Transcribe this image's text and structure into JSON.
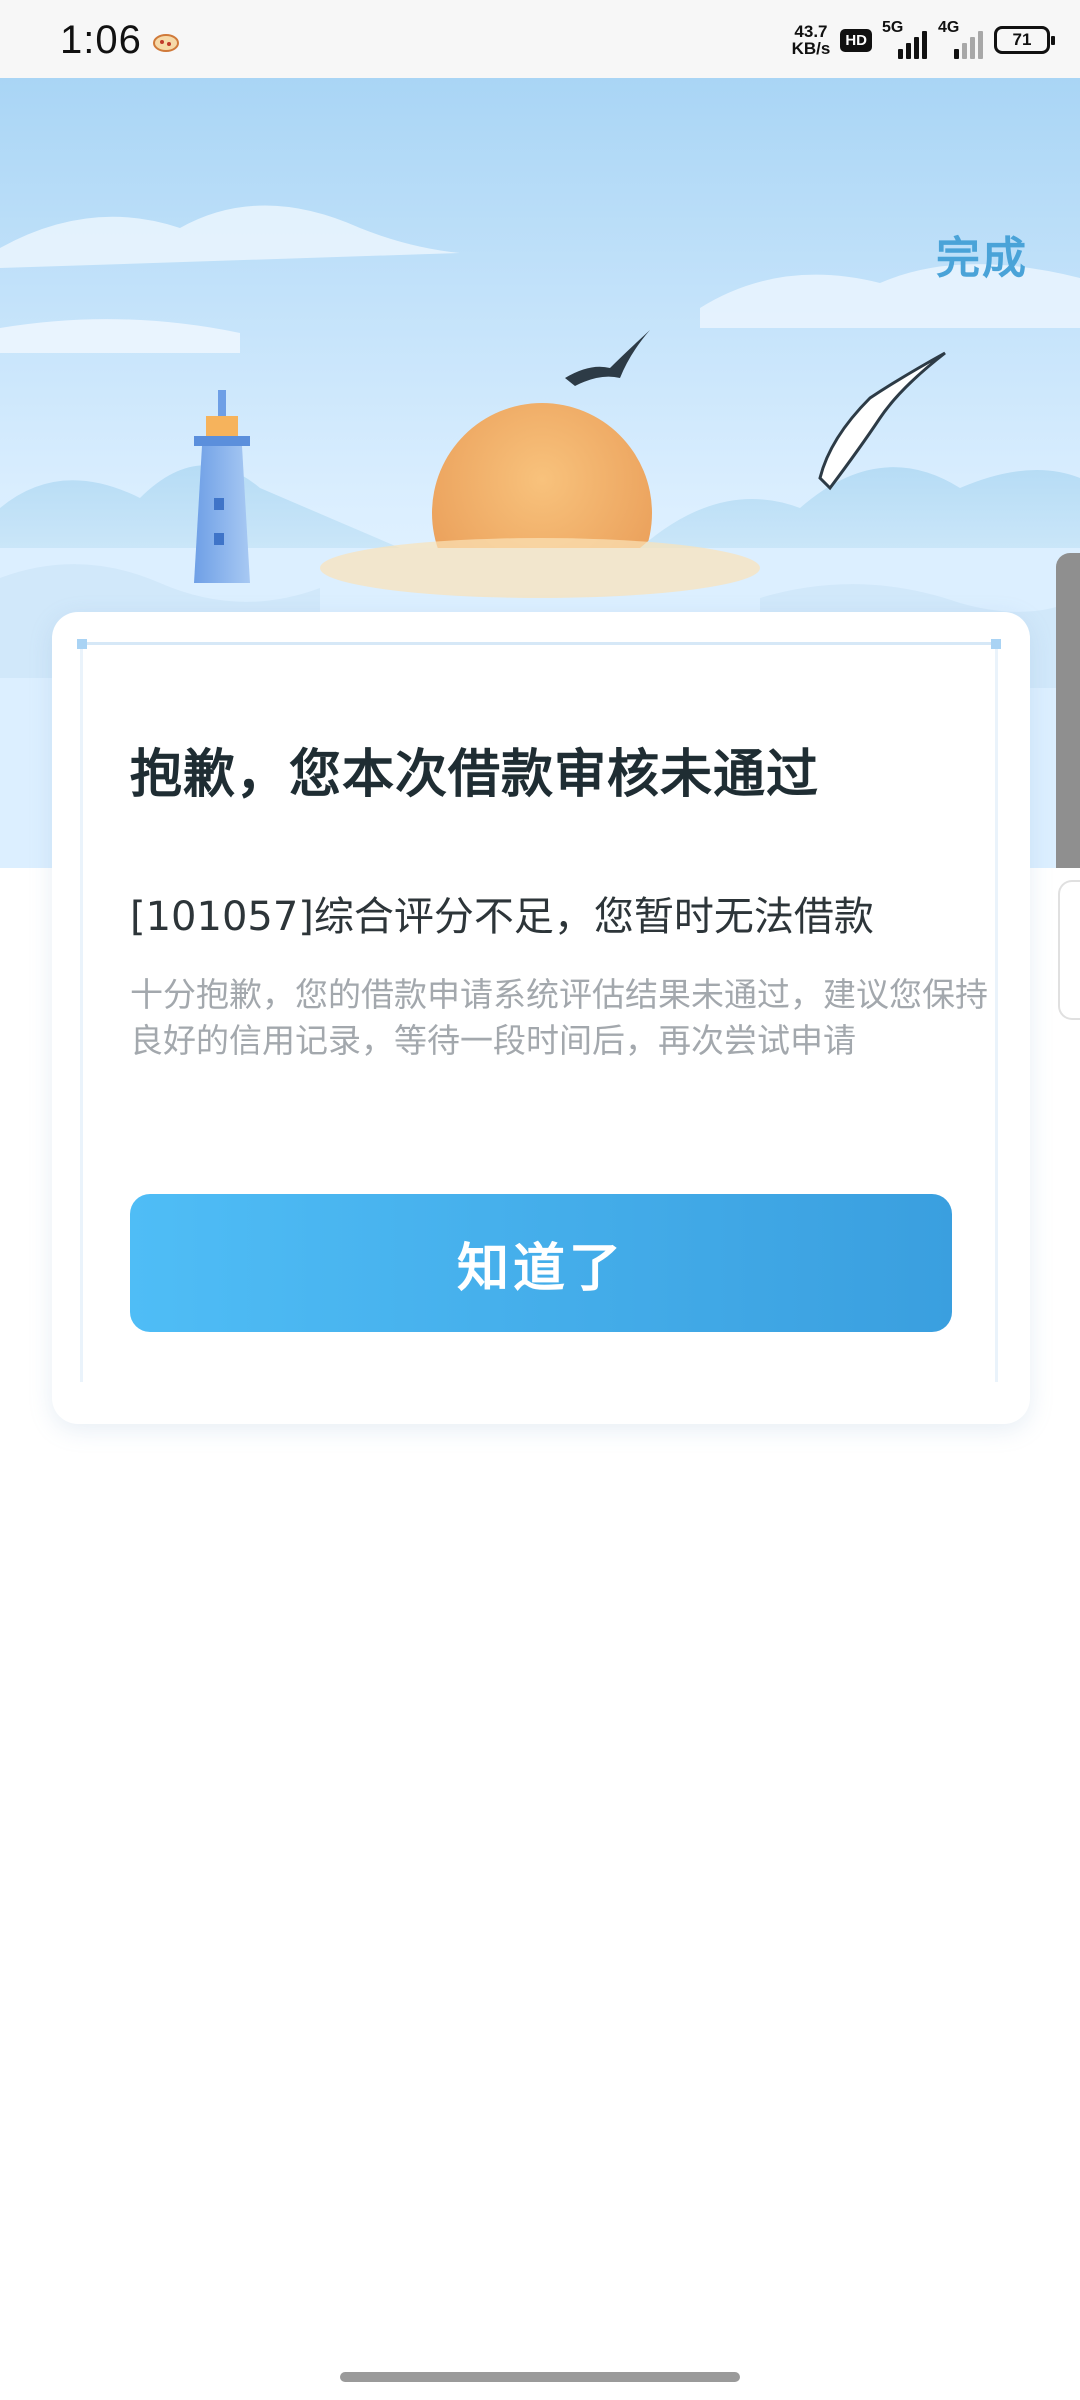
{
  "status_bar": {
    "time": "1:06",
    "net_speed_value": "43.7",
    "net_speed_unit": "KB/s",
    "hd_label": "HD",
    "sim1_label": "5G",
    "sim2_label": "4G",
    "battery": "71",
    "icons": [
      "app-notification-icon",
      "hd-icon",
      "signal-5g-icon",
      "signal-4g-icon",
      "battery-icon"
    ]
  },
  "header": {
    "done_label": "完成"
  },
  "dialog": {
    "title": "抱歉，您本次借款审核未通过",
    "reason": "[101057]综合评分不足，您暂时无法借款",
    "description": "十分抱歉，您的借款申请系统评估结果未通过，建议您保持良好的信用记录，等待一段时间后，再次尝试申请",
    "button_label": "知道了"
  },
  "colors": {
    "accent": "#4aa3d8",
    "button_start": "#4fbdf6",
    "button_end": "#3a9fdf",
    "title": "#1f2d33",
    "muted_text": "#a3a8ad"
  }
}
